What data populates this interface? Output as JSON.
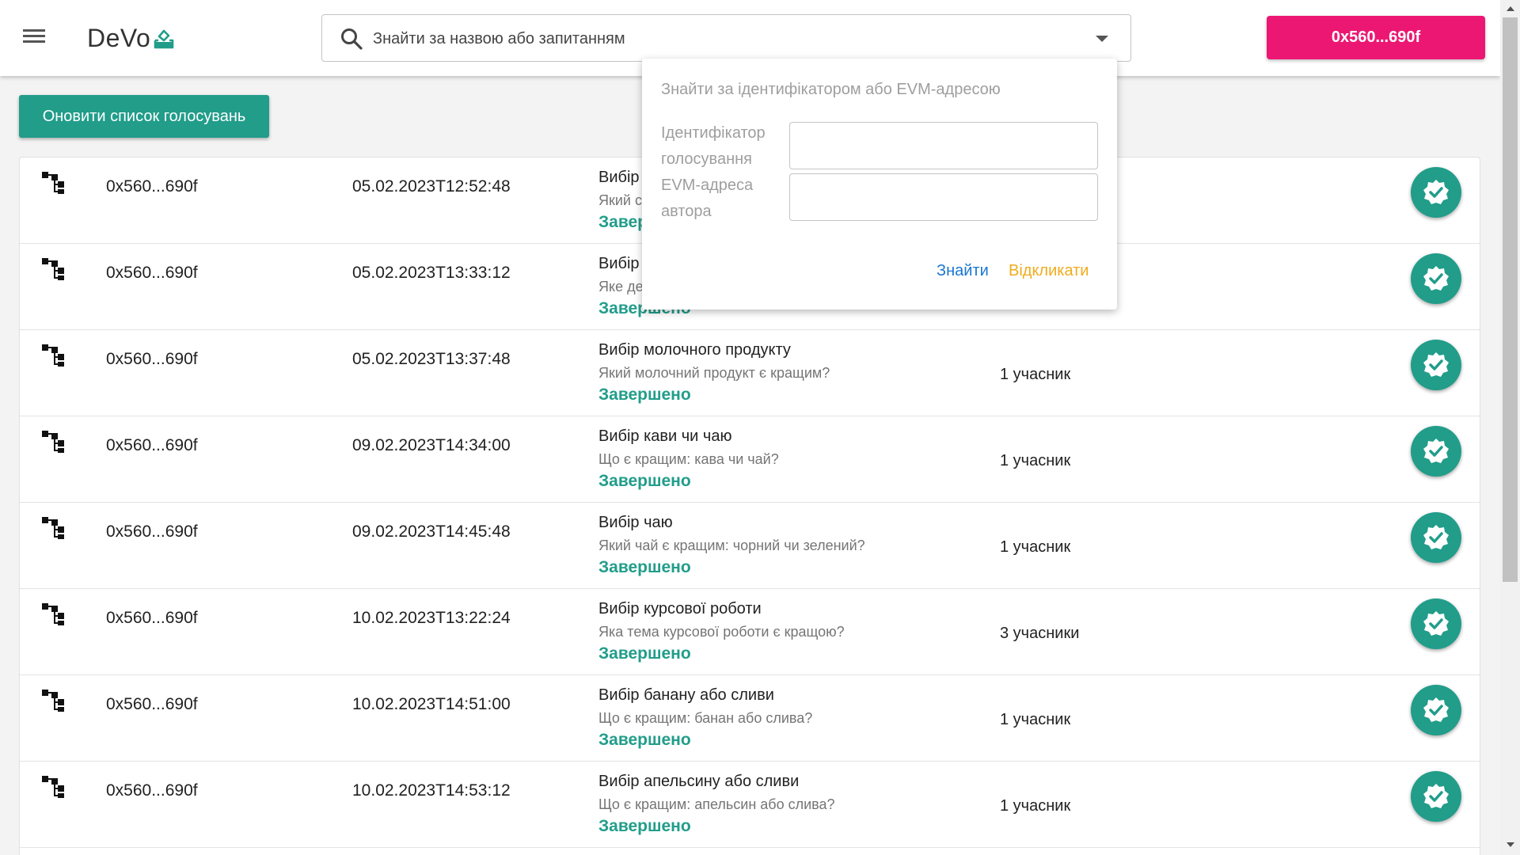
{
  "header": {
    "logo_text": "DeVo",
    "logo_icon": "ballot-box-icon",
    "search_placeholder": "Знайти за назвою або запитанням",
    "account_label": "0x560...690f",
    "accent_color": "#ec1773"
  },
  "toolbar": {
    "refresh_label": "Оновити список голосувань",
    "primary_color": "#219d8a"
  },
  "search_popup": {
    "title": "Знайти за ідентифікатором або EVM-адресою",
    "fields": [
      {
        "label_line1": "Ідентифікатор",
        "label_line2": "голосування",
        "value": ""
      },
      {
        "label_line1": "EVM-адреса",
        "label_line2": "автора",
        "value": ""
      }
    ],
    "find_label": "Знайти",
    "cancel_label": "Відкликати"
  },
  "votes": [
    {
      "author": "0x560...690f",
      "date": "05.02.2023T12:52:48",
      "title": "Вибір",
      "question": "Який с",
      "status": "Завер",
      "participants": ""
    },
    {
      "author": "0x560...690f",
      "date": "05.02.2023T13:33:12",
      "title": "Вибір",
      "question": "Яке де",
      "status": "Завершено",
      "participants": ""
    },
    {
      "author": "0x560...690f",
      "date": "05.02.2023T13:37:48",
      "title": "Вибір молочного продукту",
      "question": "Який молочний продукт є кращим?",
      "status": "Завершено",
      "participants": "1 учасник"
    },
    {
      "author": "0x560...690f",
      "date": "09.02.2023T14:34:00",
      "title": "Вибір кави чи чаю",
      "question": "Що є кращим: кава чи чай?",
      "status": "Завершено",
      "participants": "1 учасник"
    },
    {
      "author": "0x560...690f",
      "date": "09.02.2023T14:45:48",
      "title": "Вибір чаю",
      "question": "Який чай є кращим: чорний чи зелений?",
      "status": "Завершено",
      "participants": "1 учасник"
    },
    {
      "author": "0x560...690f",
      "date": "10.02.2023T13:22:24",
      "title": "Вибір курсової роботи",
      "question": "Яка тема курсової роботи є кращою?",
      "status": "Завершено",
      "participants": "3 учасники"
    },
    {
      "author": "0x560...690f",
      "date": "10.02.2023T14:51:00",
      "title": "Вибір банану або сливи",
      "question": "Що є кращим: банан або слива?",
      "status": "Завершено",
      "participants": "1 учасник"
    },
    {
      "author": "0x560...690f",
      "date": "10.02.2023T14:53:12",
      "title": "Вибір апельсину або сливи",
      "question": "Що є кращим: апельсин або слива?",
      "status": "Завершено",
      "participants": "1 учасник"
    }
  ]
}
